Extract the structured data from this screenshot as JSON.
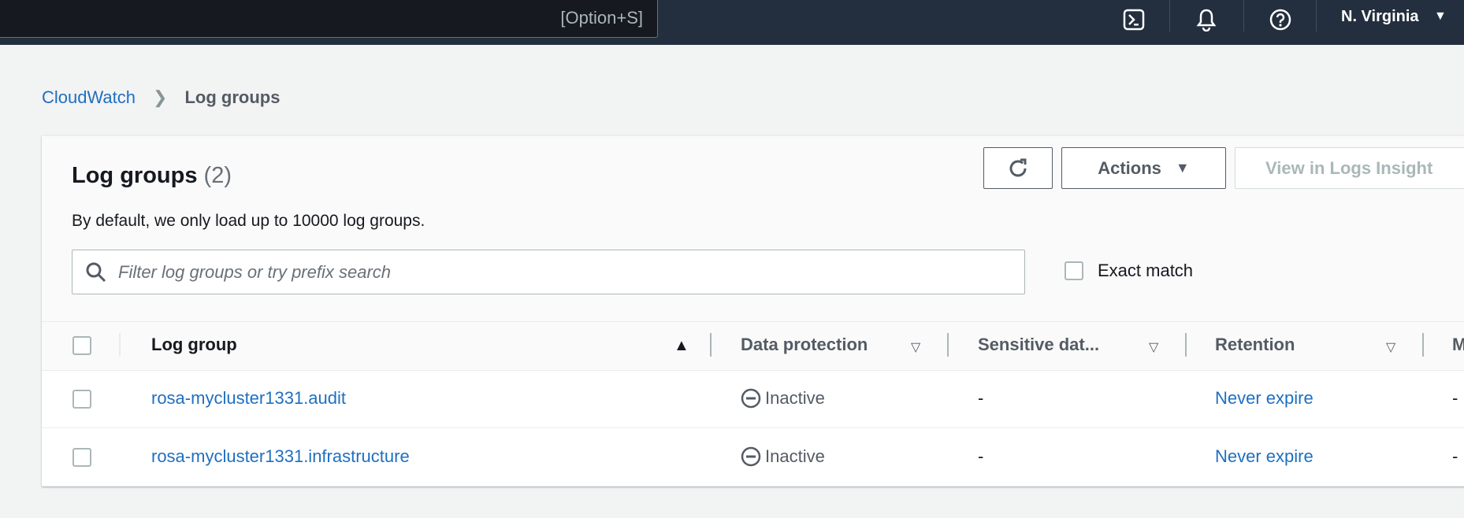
{
  "topbar": {
    "search_shortcut": "[Option+S]",
    "icons": [
      "cloudshell-icon",
      "bell-icon",
      "help-icon"
    ],
    "region": "N. Virginia"
  },
  "breadcrumb": {
    "parent": "CloudWatch",
    "current": "Log groups"
  },
  "panel": {
    "title": "Log groups",
    "count": "(2)",
    "description": "By default, we only load up to 10000 log groups.",
    "refresh_icon": "refresh-icon",
    "actions_label": "Actions",
    "view_insights_label": "View in Logs Insight",
    "search_placeholder": "Filter log groups or try prefix search",
    "search_value": "",
    "exact_match_label": "Exact match"
  },
  "table": {
    "columns": [
      "Log group",
      "Data protection",
      "Sensitive dat...",
      "Retention",
      "M"
    ],
    "rows": [
      {
        "log_group": "rosa-mycluster1331.audit",
        "data_protection": "Inactive",
        "sensitive": "-",
        "retention": "Never expire",
        "m": "-"
      },
      {
        "log_group": "rosa-mycluster1331.infrastructure",
        "data_protection": "Inactive",
        "sensitive": "-",
        "retention": "Never expire",
        "m": "-"
      }
    ]
  },
  "colors": {
    "nav": "#232f3e",
    "link": "#1f6fc0",
    "background": "#f2f3f3"
  }
}
